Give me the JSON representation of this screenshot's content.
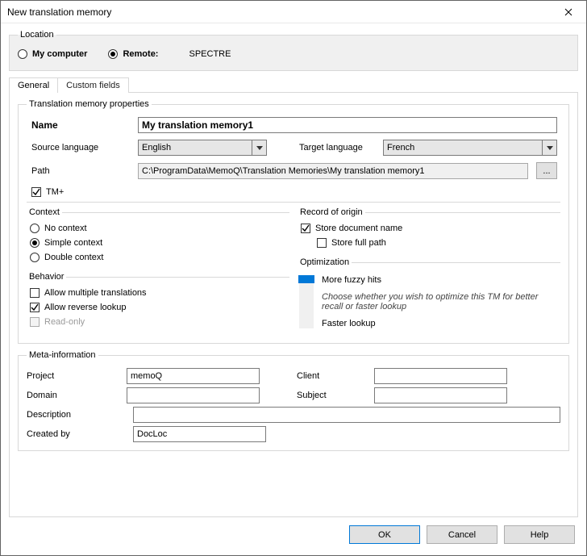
{
  "window": {
    "title": "New translation memory"
  },
  "location": {
    "legend": "Location",
    "my_computer": "My computer",
    "remote": "Remote:",
    "remote_value": "SPECTRE",
    "selected": "remote"
  },
  "tabs": {
    "general": "General",
    "custom": "Custom fields",
    "active": "general"
  },
  "tm_props": {
    "legend": "Translation memory properties",
    "name_label": "Name",
    "name_value": "My translation memory1",
    "src_label": "Source language",
    "src_value": "English",
    "tgt_label": "Target language",
    "tgt_value": "French",
    "path_label": "Path",
    "path_value": "C:\\ProgramData\\MemoQ\\Translation Memories\\My translation memory1",
    "browse": "...",
    "tmplus": "TM+"
  },
  "context": {
    "legend": "Context",
    "none": "No context",
    "simple": "Simple context",
    "double": "Double context",
    "selected": "simple"
  },
  "behavior": {
    "legend": "Behavior",
    "multi": "Allow multiple translations",
    "reverse": "Allow reverse lookup",
    "readonly": "Read-only",
    "multi_checked": false,
    "reverse_checked": true,
    "readonly_checked": false,
    "readonly_enabled": false
  },
  "record": {
    "legend": "Record of origin",
    "store_doc": "Store document name",
    "store_full": "Store full path",
    "doc_checked": true,
    "full_checked": false
  },
  "optim": {
    "legend": "Optimization",
    "top": "More fuzzy hits",
    "hint": "Choose whether you wish to optimize this TM for better recall or faster lookup",
    "bottom": "Faster lookup"
  },
  "meta": {
    "legend": "Meta-information",
    "project_label": "Project",
    "project_value": "memoQ",
    "client_label": "Client",
    "client_value": "",
    "domain_label": "Domain",
    "domain_value": "",
    "subject_label": "Subject",
    "subject_value": "",
    "desc_label": "Description",
    "desc_value": "",
    "created_label": "Created by",
    "created_value": "DocLoc"
  },
  "buttons": {
    "ok": "OK",
    "cancel": "Cancel",
    "help": "Help"
  }
}
